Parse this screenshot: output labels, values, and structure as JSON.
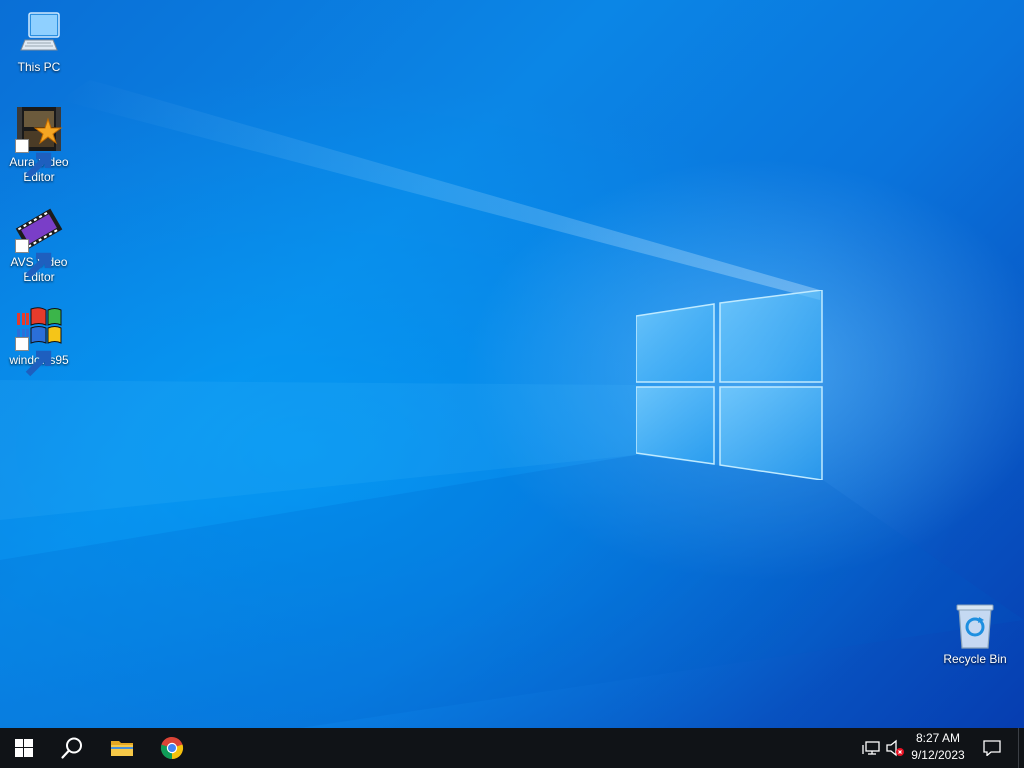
{
  "desktop": {
    "icons": [
      {
        "label": "This PC",
        "icon": "computer-icon"
      },
      {
        "label": "Aura Video Editor",
        "icon": "aura-video-editor-icon",
        "shortcut": true
      },
      {
        "label": "AVS Video Editor",
        "icon": "avs-video-editor-icon",
        "shortcut": true
      },
      {
        "label": "windows95",
        "icon": "windows95-icon",
        "shortcut": true
      },
      {
        "label": "Recycle Bin",
        "icon": "recycle-bin-icon"
      }
    ],
    "wallpaper": {
      "accent": "#0a78dc",
      "logo": "windows-logo"
    }
  },
  "taskbar": {
    "background": "#101317",
    "buttons": [
      {
        "name": "start-button",
        "icon": "windows-start-icon"
      },
      {
        "name": "search-button",
        "icon": "search-icon"
      },
      {
        "name": "file-explorer-button",
        "icon": "folder-icon"
      },
      {
        "name": "chrome-button",
        "icon": "chrome-icon"
      }
    ],
    "tray": {
      "network_icon": "network-icon",
      "volume_icon": "volume-muted-icon",
      "time": "8:27 AM",
      "date": "9/12/2023",
      "notifications_icon": "action-center-icon"
    }
  }
}
